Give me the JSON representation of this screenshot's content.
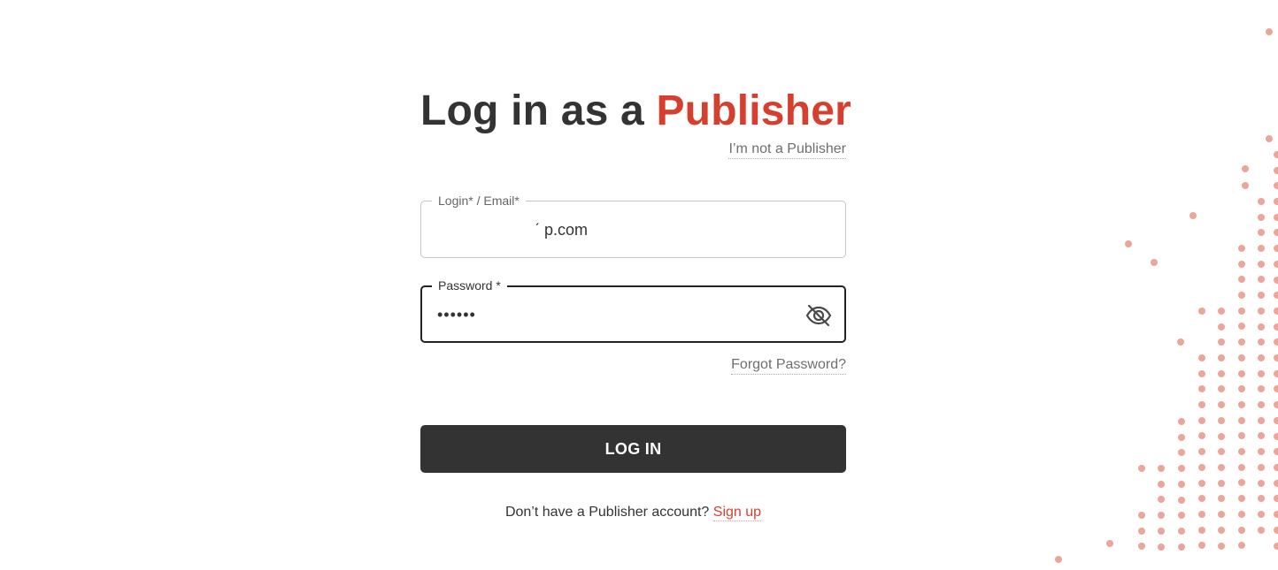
{
  "heading": {
    "prefix": "Log in as a",
    "accent": "Publisher"
  },
  "not_publisher_link": "I’m not a Publisher",
  "email_field": {
    "label": "Login* / Email*",
    "value": "                      ˊ p.com"
  },
  "password_field": {
    "label": "Password *",
    "value": "••••••"
  },
  "forgot_password_link": "Forgot Password?",
  "login_button": "LOG IN",
  "signup": {
    "prompt": "Don’t have a Publisher account?",
    "link": "Sign up"
  },
  "icons": {
    "password_toggle": "eye-slash-icon"
  },
  "colors": {
    "accent": "#d63f2e",
    "dark": "#333333",
    "dots": "#eba59a"
  }
}
